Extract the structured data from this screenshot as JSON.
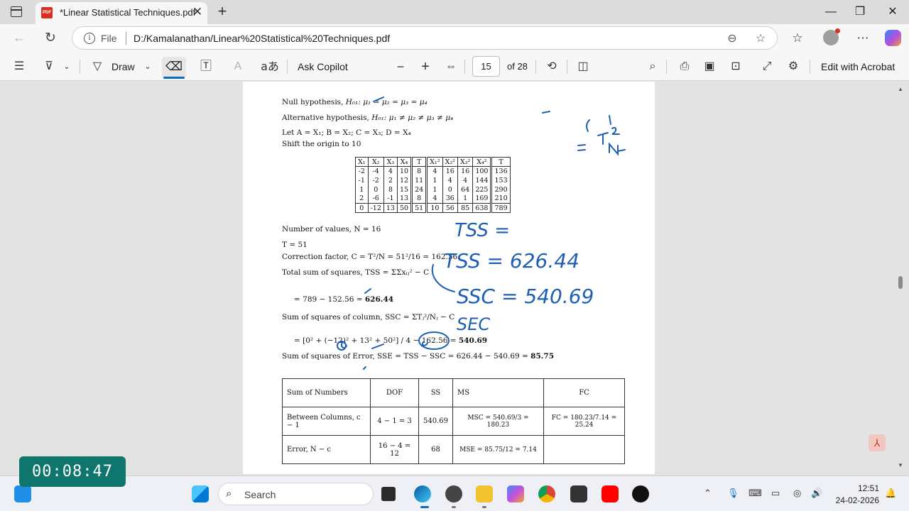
{
  "browser": {
    "tab_title": "*Linear Statistical Techniques.pdf",
    "pdf_badge": "PDF",
    "file_label": "File",
    "url": "D:/Kamalanathan/Linear%20Statistical%20Techniques.pdf"
  },
  "pdf_toolbar": {
    "draw_label": "Draw",
    "ask_copilot_label": "Ask Copilot",
    "page_current": "15",
    "page_total": "of 28",
    "edit_acrobat_label": "Edit with Acrobat",
    "accent_color": "#0f6cbd"
  },
  "document": {
    "null_hyp_label": "Null hypothesis, ",
    "null_hyp_math": "H₀₁: μ₁ = μ₂ = μ₃ = μ₄",
    "alt_hyp_label": "Alternative hypothesis, ",
    "alt_hyp_math": "H₀₁: μ₁ ≠ μ₂ ≠ μ₃ ≠ μ₄",
    "let_line": "Let A = X₁; B = X₂; C = X₃; D = X₄",
    "shift_line": "Shift the origin to 10",
    "table_headers": [
      "X₁",
      "X₂",
      "X₃",
      "X₄",
      "T",
      "X₁²",
      "X₂²",
      "X₃²",
      "X₄²",
      "T"
    ],
    "table_rows": [
      [
        "-2",
        "-4",
        "4",
        "10",
        "8",
        "4",
        "16",
        "16",
        "100",
        "136"
      ],
      [
        "-1",
        "-2",
        "2",
        "12",
        "11",
        "1",
        "4",
        "4",
        "144",
        "153"
      ],
      [
        "1",
        "0",
        "8",
        "15",
        "24",
        "1",
        "0",
        "64",
        "225",
        "290"
      ],
      [
        "2",
        "-6",
        "-1",
        "13",
        "8",
        "4",
        "36",
        "1",
        "169",
        "210"
      ]
    ],
    "table_totals": [
      "0",
      "-12",
      "13",
      "50",
      "51",
      "10",
      "56",
      "85",
      "638",
      "789"
    ],
    "num_values": "Number of values, N = 16",
    "t_line": "T = 51",
    "cf_line": "Correction factor, C = T²/N = 51²/16 = 162.56",
    "tss_line": "Total sum of squares, TSS = ΣΣxᵢⱼ² − C",
    "tss_calc": "= 789 − 152.56 = ",
    "tss_value": "626.44",
    "ssc_line": "Sum of squares of column, SSC = ΣTⱼ²/Nⱼ − C",
    "ssc_calc": "= [0² + (−12)² + 13² + 50²] / 4 − 162.56 = ",
    "ssc_value": "540.69",
    "sse_line": "Sum of squares of Error, SSE = TSS − SSC = 626.44 − 540.69 = ",
    "sse_value": "85.75",
    "anova_headers": [
      "Sum of Numbers",
      "DOF",
      "SS",
      "MS",
      "FC"
    ],
    "anova_rows": [
      [
        "Between Columns, c − 1",
        "4 − 1 = 3",
        "540.69",
        "MSC = 540.69/3 = 180.23",
        "FC = 180.23/7.14 = 25.24"
      ],
      [
        "Error, N − c",
        "16 − 4 = 12",
        "68",
        "MSE = 85.75/12 = 7.14",
        ""
      ]
    ]
  },
  "handwriting": {
    "ink_color": "#1f5fb3",
    "lines": [
      "TSS =",
      "TSS = 626.44",
      "SSC = 540.69",
      "SEC"
    ]
  },
  "timer": "00:08:47",
  "taskbar": {
    "search_placeholder": "Search",
    "time": "12:51",
    "date": "24-02-2026"
  }
}
